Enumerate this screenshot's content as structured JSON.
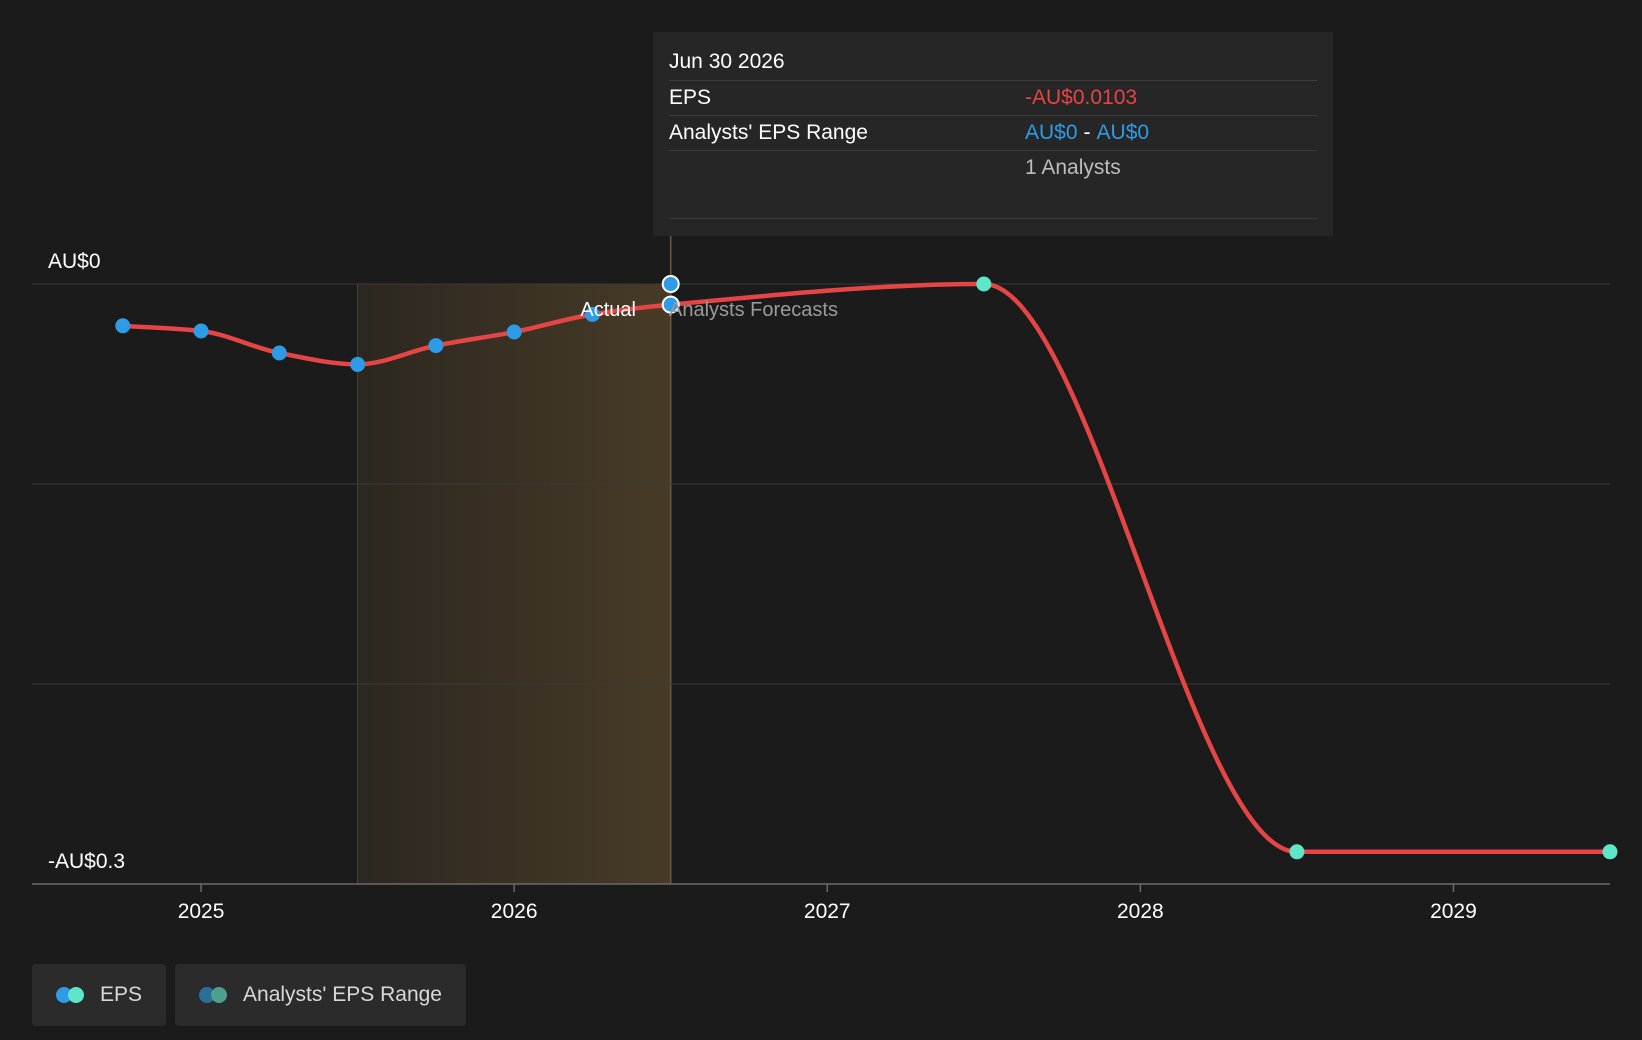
{
  "tooltip": {
    "date": "Jun 30 2026",
    "eps_label": "EPS",
    "eps_value": "-AU$0.0103",
    "range_label": "Analysts' EPS Range",
    "range_low": "AU$0",
    "range_sep": "-",
    "range_high": "AU$0",
    "analysts": "1 Analysts"
  },
  "markers": {
    "actual": "Actual",
    "forecast": "Analysts Forecasts"
  },
  "legend": {
    "eps": "EPS",
    "range": "Analysts' EPS Range"
  },
  "colors": {
    "background": "#1b1b1b",
    "eps_line": "#e64545",
    "actual_point": "#2e9be6",
    "forecast_point": "#5ee6c8",
    "highlight_band": "#4a3d28",
    "range_dot_a": "#2a6f9a",
    "range_dot_b": "#4d9f8f"
  },
  "chart_data": {
    "type": "line",
    "title": "",
    "xlabel": "",
    "ylabel": "",
    "x_ticks": [
      "2025",
      "2026",
      "2027",
      "2028",
      "2029"
    ],
    "y_tick_labels": [
      "AU$0",
      "-AU$0.3"
    ],
    "ylim": [
      -0.3,
      0
    ],
    "xlim": [
      2024.46,
      2029.5
    ],
    "grid": true,
    "highlight_range": [
      2025.5,
      2026.5
    ],
    "series": [
      {
        "name": "EPS",
        "points": [
          {
            "x": 2024.75,
            "y": -0.0209,
            "kind": "actual"
          },
          {
            "x": 2025.0,
            "y": -0.0235,
            "kind": "actual"
          },
          {
            "x": 2025.25,
            "y": -0.0345,
            "kind": "actual"
          },
          {
            "x": 2025.5,
            "y": -0.0402,
            "kind": "actual"
          },
          {
            "x": 2025.75,
            "y": -0.0308,
            "kind": "actual"
          },
          {
            "x": 2026.0,
            "y": -0.024,
            "kind": "actual"
          },
          {
            "x": 2026.25,
            "y": -0.0152,
            "kind": "actual"
          },
          {
            "x": 2026.5,
            "y": -0.0103,
            "kind": "actual"
          },
          {
            "x": 2027.5,
            "y": 0.0,
            "kind": "forecast"
          },
          {
            "x": 2028.5,
            "y": -0.2839,
            "kind": "forecast"
          },
          {
            "x": 2029.5,
            "y": -0.2839,
            "kind": "forecast"
          }
        ]
      }
    ]
  }
}
